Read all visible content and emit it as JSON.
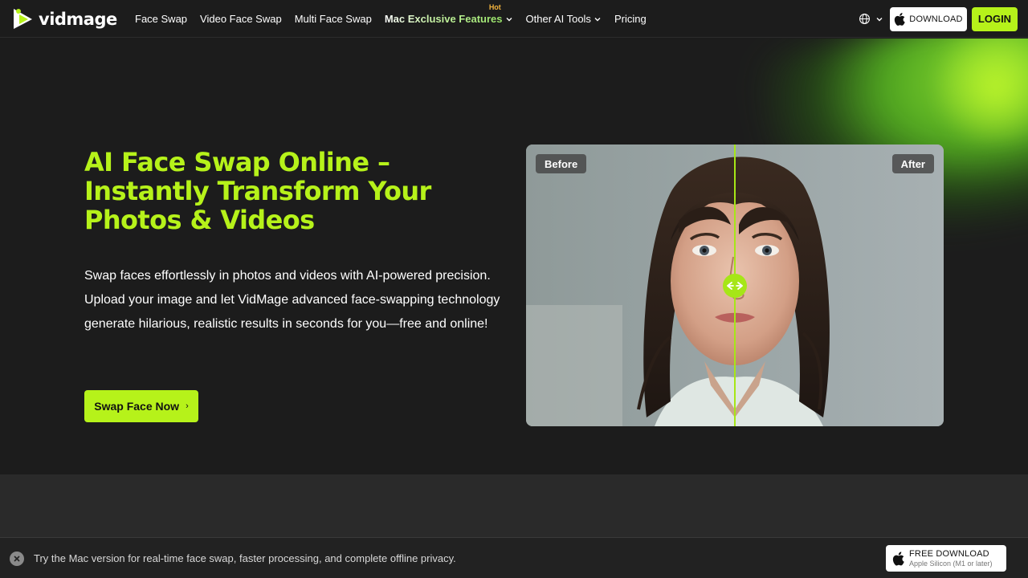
{
  "brand": {
    "name": "vidmage",
    "accent": "#b6f21a"
  },
  "nav": {
    "items": [
      {
        "label": "Face Swap"
      },
      {
        "label": "Video Face Swap"
      },
      {
        "label": "Multi Face Swap"
      },
      {
        "label": "Mac Exclusive Features",
        "badge": "Hot",
        "dropdown": true
      },
      {
        "label": "Other AI Tools",
        "dropdown": true
      },
      {
        "label": "Pricing"
      }
    ],
    "language_icon": "globe-icon",
    "download_label": "DOWNLOAD",
    "login_label": "LOGIN"
  },
  "hero": {
    "title": "AI Face Swap Online – Instantly Transform Your Photos & Videos",
    "description": "Swap faces effortlessly in photos and videos with AI-powered precision. Upload your image and let VidMage advanced face-swapping technology generate hilarious, realistic results in seconds for you—free and online!",
    "cta_label": "Swap Face Now",
    "cta_arrow": "›"
  },
  "comparison": {
    "before_label": "Before",
    "after_label": "After",
    "slider_icon": "left-right-arrows-icon",
    "split_fraction": 0.5
  },
  "bottom_bar": {
    "message": "Try the Mac version for real-time face swap, faster processing, and complete offline privacy.",
    "download_title": "FREE DOWNLOAD",
    "download_subtitle": "Apple Silicon (M1 or later)",
    "close_icon": "close-icon"
  }
}
